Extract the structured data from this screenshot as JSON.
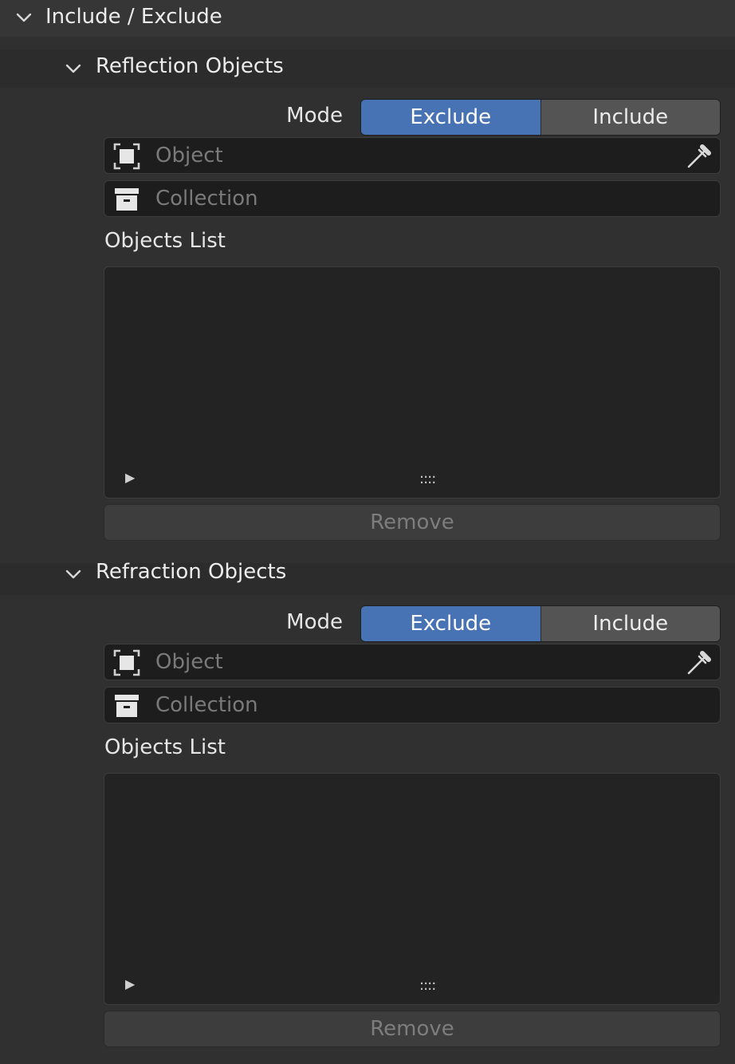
{
  "panel": {
    "title": "Include / Exclude"
  },
  "sections": [
    {
      "title": "Reflection Objects",
      "mode_label": "Mode",
      "mode_options": [
        "Exclude",
        "Include"
      ],
      "mode_selected": "Exclude",
      "object_placeholder": "Object",
      "collection_placeholder": "Collection",
      "list_label": "Objects List",
      "list_grip": "::::",
      "list_expand": "▶",
      "remove_label": "Remove"
    },
    {
      "title": "Refraction Objects",
      "mode_label": "Mode",
      "mode_options": [
        "Exclude",
        "Include"
      ],
      "mode_selected": "Exclude",
      "object_placeholder": "Object",
      "collection_placeholder": "Collection",
      "list_label": "Objects List",
      "list_grip": "::::",
      "list_expand": "▶",
      "remove_label": "Remove"
    }
  ],
  "icons": {
    "chevron": "chevron-down-icon",
    "object": "object-icon",
    "collection": "collection-icon",
    "eyedropper": "eyedropper-icon"
  },
  "colors": {
    "accent": "#4772b3",
    "background": "#303030",
    "field": "#1d1d1d"
  }
}
